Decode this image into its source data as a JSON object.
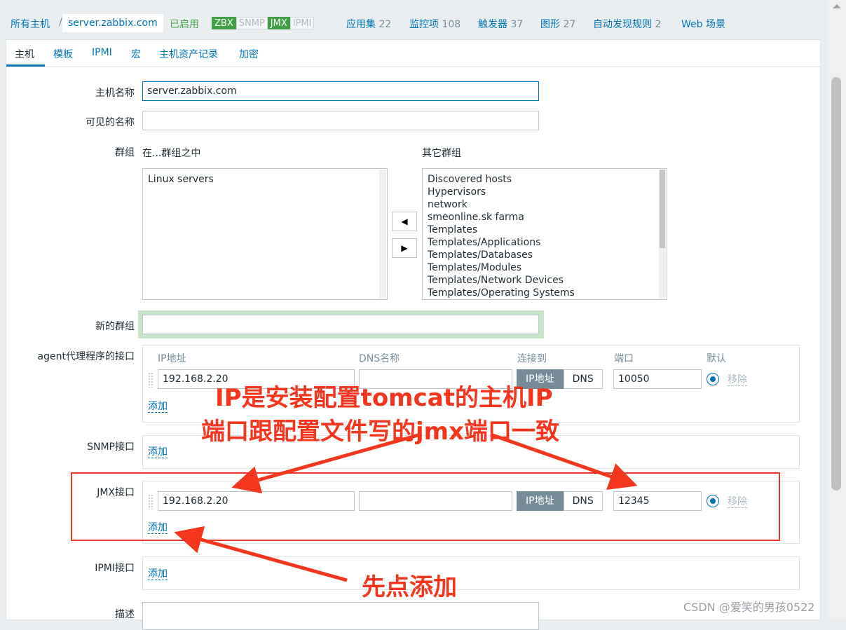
{
  "breadcrumb": {
    "all_hosts": "所有主机",
    "separator": "/",
    "host": "server.zabbix.com"
  },
  "status": {
    "enabled": "已启用"
  },
  "availability": [
    {
      "label": "ZBX",
      "active": true
    },
    {
      "label": "SNMP",
      "active": false
    },
    {
      "label": "JMX",
      "active": true
    },
    {
      "label": "IPMI",
      "active": false
    }
  ],
  "nav": [
    {
      "label": "应用集",
      "count": "22"
    },
    {
      "label": "监控项",
      "count": "108"
    },
    {
      "label": "触发器",
      "count": "37"
    },
    {
      "label": "图形",
      "count": "27"
    },
    {
      "label": "自动发现规则",
      "count": "2"
    },
    {
      "label": "Web 场景",
      "count": ""
    }
  ],
  "tabs": [
    "主机",
    "模板",
    "IPMI",
    "宏",
    "主机资产记录",
    "加密"
  ],
  "form": {
    "host_name_label": "主机名称",
    "host_name_value": "server.zabbix.com",
    "visible_name_label": "可见的名称",
    "visible_name_value": "",
    "groups_label": "群组",
    "in_groups_label": "在...群组之中",
    "other_groups_label": "其它群组",
    "in_groups": [
      "Linux servers"
    ],
    "other_groups": [
      "Discovered hosts",
      "Hypervisors",
      "network",
      "smeonline.sk farma",
      "Templates",
      "Templates/Applications",
      "Templates/Databases",
      "Templates/Modules",
      "Templates/Network Devices",
      "Templates/Operating Systems"
    ],
    "new_group_label": "新的群组",
    "new_group_value": "",
    "description_label": "描述"
  },
  "interfaces": {
    "headers": {
      "ip": "IP地址",
      "dns": "DNS名称",
      "connect": "连接到",
      "port": "端口",
      "default": "默认"
    },
    "agent": {
      "label": "agent代理程序的接口",
      "ip": "192.168.2.20",
      "dns": "",
      "connect_ip": "IP地址",
      "connect_dns": "DNS",
      "port": "10050",
      "remove": "移除",
      "add": "添加"
    },
    "snmp": {
      "label": "SNMP接口",
      "add": "添加"
    },
    "jmx": {
      "label": "JMX接口",
      "ip": "192.168.2.20",
      "dns": "",
      "connect_ip": "IP地址",
      "connect_dns": "DNS",
      "port": "12345",
      "remove": "移除",
      "add": "添加"
    },
    "ipmi": {
      "label": "IPMI接口",
      "add": "添加"
    }
  },
  "annotations": {
    "line1": "IP是安装配置tomcat的主机IP",
    "line2": "端口跟配置文件写的jmx端口一致",
    "line3": "先点添加"
  },
  "watermark": "CSDN @爱笑的男孩0522",
  "colors": {
    "accent": "#0275b8",
    "enabled": "#429e47",
    "annotation": "#f4361e"
  }
}
